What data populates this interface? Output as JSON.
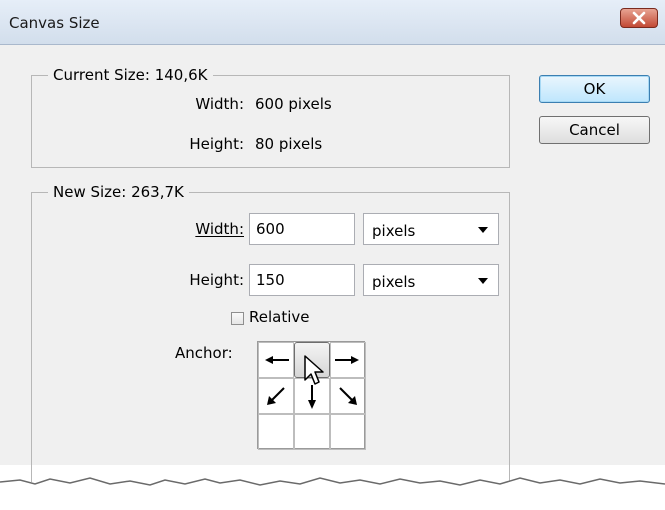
{
  "window": {
    "title": "Canvas Size"
  },
  "current_size": {
    "legend": "Current Size: 140,6K",
    "width_label": "Width:",
    "width_value": "600 pixels",
    "height_label": "Height:",
    "height_value": "80 pixels"
  },
  "new_size": {
    "legend": "New Size: 263,7K",
    "width_label": "Width:",
    "width_value": "600",
    "width_unit": "pixels",
    "height_label": "Height:",
    "height_value": "150",
    "height_unit": "pixels",
    "relative_label": "Relative",
    "relative_checked": false,
    "anchor_label": "Anchor:",
    "anchor_selected": "top-center"
  },
  "buttons": {
    "ok": "OK",
    "cancel": "Cancel"
  },
  "icons": {
    "close": "close-icon",
    "anchor_arrows": [
      "arrow-left-icon",
      "arrow-right-icon",
      "arrow-down-left-icon",
      "arrow-down-icon",
      "arrow-down-right-icon"
    ],
    "cursor": "mouse-pointer-icon"
  }
}
